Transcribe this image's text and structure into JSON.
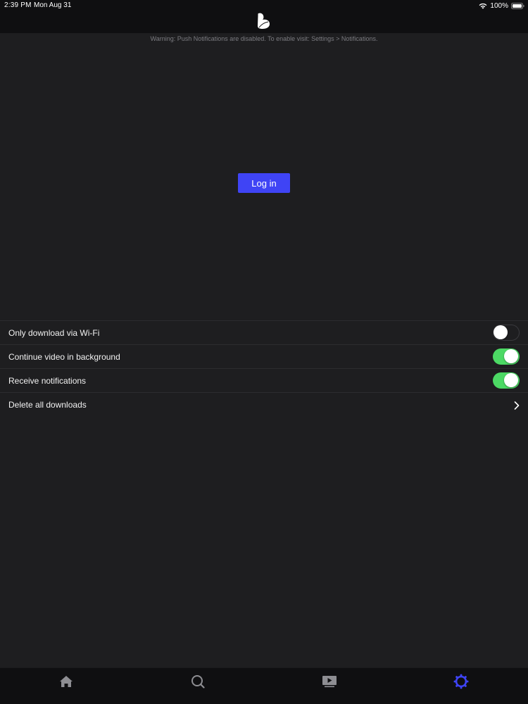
{
  "status_bar": {
    "time": "2:39 PM",
    "date": "Mon Aug 31",
    "battery": "100%",
    "wifi_icon": "wifi-icon",
    "battery_icon": "battery-icon"
  },
  "header": {
    "logo_icon": "b-logo-icon"
  },
  "warning": "Warning: Push Notifications are disabled. To enable visit: Settings > Notifications.",
  "login_button": "Log in",
  "colors": {
    "accent": "#3f44f5",
    "toggle_on": "#4cd964",
    "background": "#1e1e20"
  },
  "settings": [
    {
      "label": "Only download via Wi-Fi",
      "control": "toggle",
      "on": false
    },
    {
      "label": "Continue video in background",
      "control": "toggle",
      "on": true
    },
    {
      "label": "Receive notifications",
      "control": "toggle",
      "on": true
    },
    {
      "label": "Delete all downloads",
      "control": "chevron-right-icon"
    }
  ],
  "tabs": [
    {
      "icon": "home-icon",
      "active": false
    },
    {
      "icon": "search-icon",
      "active": false
    },
    {
      "icon": "video-icon",
      "active": false
    },
    {
      "icon": "settings-gear-icon",
      "active": true
    }
  ]
}
